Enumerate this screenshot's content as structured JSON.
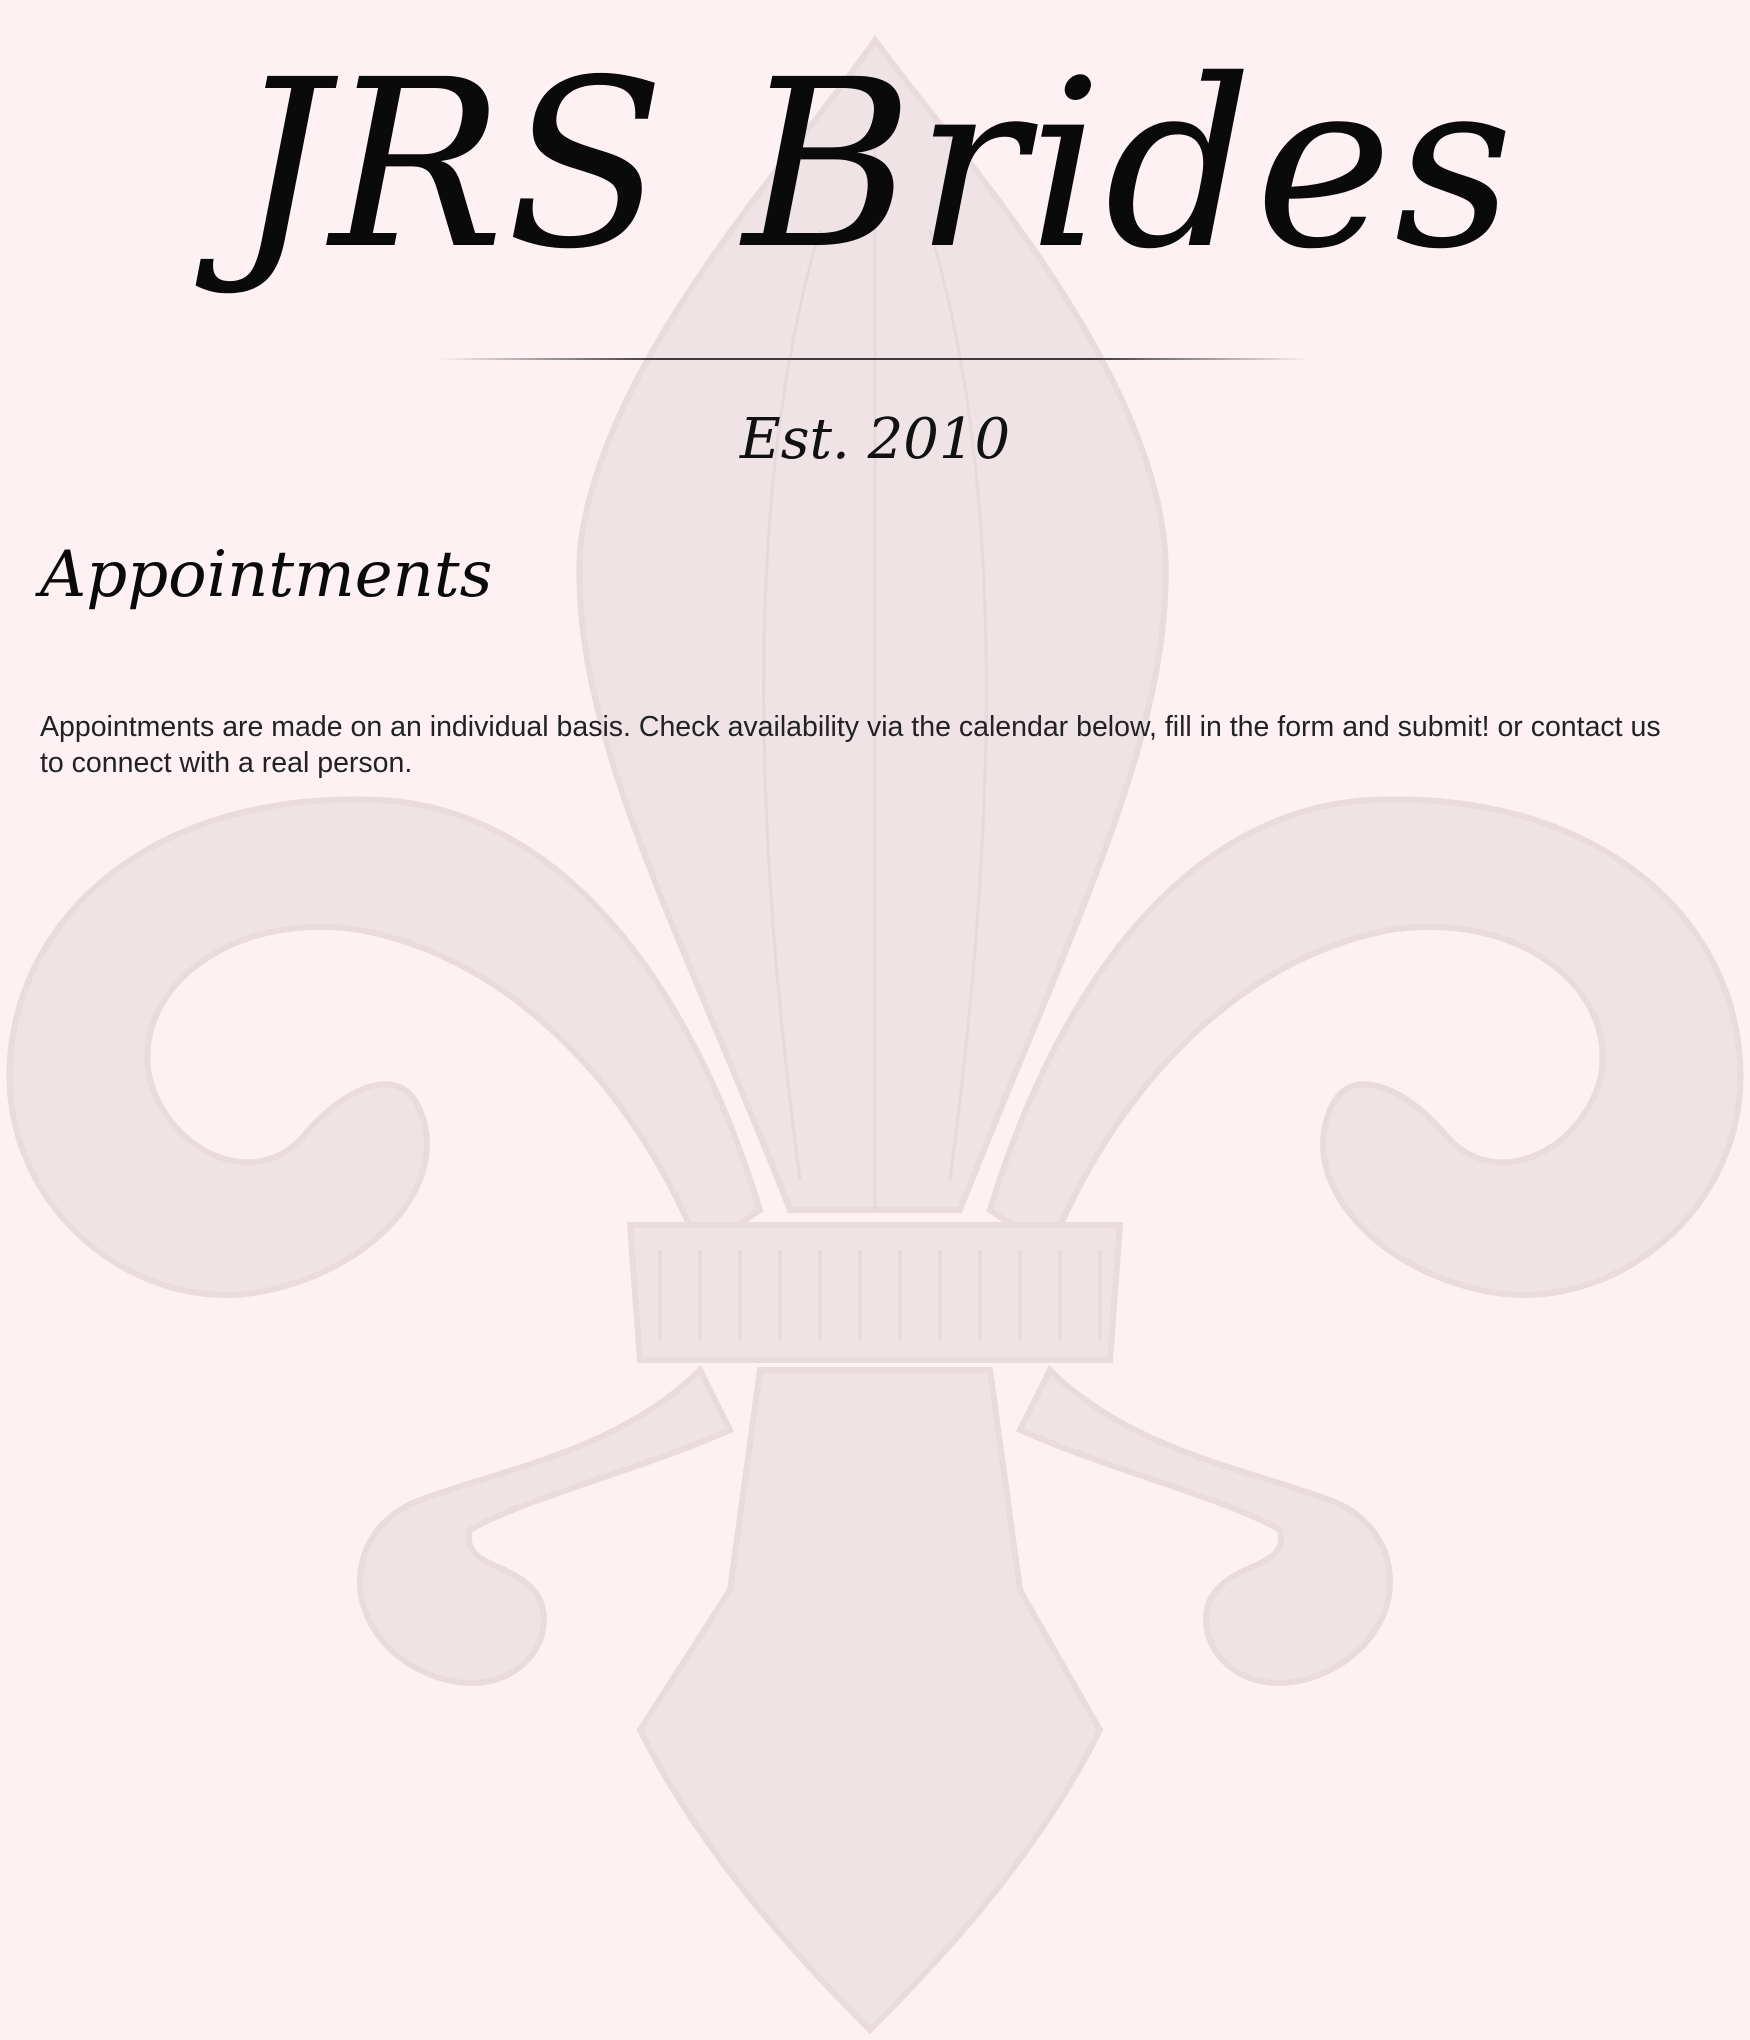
{
  "header": {
    "title": "JRS Brides",
    "established": "Est. 2010"
  },
  "main": {
    "heading": "Appointments",
    "description": "Appointments are made on an individual basis. Check availability via the calendar below, fill in the form and submit! or contact us to connect with a real person."
  },
  "colors": {
    "background": "#fdf1f3",
    "watermark": "#efe3e5",
    "text": "#0a0a0a"
  },
  "background_icon": "fleur-de-lis-icon"
}
